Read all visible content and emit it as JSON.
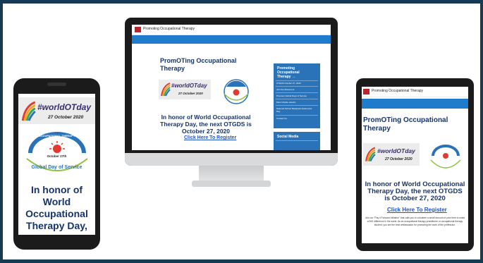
{
  "site": {
    "title": "Promoting Occupational Therapy",
    "heading": "PromOTing Occupational Therapy",
    "hashtag": "#worldOTday",
    "date_banner": "27 October 2020",
    "honor_text": "In honor of World Occupational Therapy Day, the next OTGDS is October 27, 2020",
    "phone_honor_text": "In honor of World Occupational Therapy Day,",
    "register_link": "Click Here To Register",
    "tablet_body": "Join our \"Pay it Forward Initiative\" that calls you to volunteer a small amount of your time to make a BIG difference in the world. As an occupational therapy practitioner or occupational therapy student, you are the best ambassador for promoting the work of the profession."
  },
  "gds_logo": {
    "arc_text": "Global Day of Service",
    "top_text": "OCCUPATIONAL THERAPY",
    "date": "October 27th"
  },
  "sidebar": {
    "heading": "Promoting Occupational Therapy →",
    "items": [
      "OTGDS October 27, 2020",
      "Join the Movement",
      "Previous Global Days of Service",
      "Meet Charlie Jacobs",
      "National School Backpack Awareness Day",
      "Contact Us"
    ],
    "social_heading": "Social Media"
  },
  "colors": {
    "accent_blue": "#1f7ccc",
    "sidebar_blue": "#2b73b8",
    "heading_navy": "#16336b",
    "link_blue": "#1f55c9",
    "logo_red": "#c0222b",
    "frame": "#163a52"
  }
}
